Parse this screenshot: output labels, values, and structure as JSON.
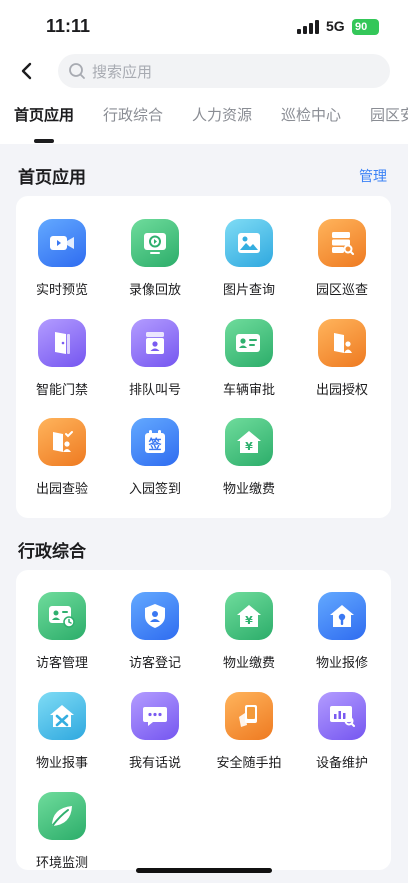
{
  "status_bar": {
    "time": "11:11",
    "network": "5G",
    "battery": "90"
  },
  "search": {
    "placeholder": "搜索应用"
  },
  "tabs": [
    {
      "label": "首页应用",
      "active": true
    },
    {
      "label": "行政综合"
    },
    {
      "label": "人力资源"
    },
    {
      "label": "巡检中心"
    },
    {
      "label": "园区安"
    }
  ],
  "section_home": {
    "title": "首页应用",
    "manage_label": "管理",
    "apps": [
      {
        "label": "实时预览",
        "icon": "video-camera-icon",
        "color": "blue"
      },
      {
        "label": "录像回放",
        "icon": "playback-icon",
        "color": "green"
      },
      {
        "label": "图片查询",
        "icon": "image-icon",
        "color": "cyan"
      },
      {
        "label": "园区巡查",
        "icon": "server-search-icon",
        "color": "orange"
      },
      {
        "label": "智能门禁",
        "icon": "door-icon",
        "color": "purple"
      },
      {
        "label": "排队叫号",
        "icon": "queue-ticket-icon",
        "color": "purple"
      },
      {
        "label": "车辆审批",
        "icon": "id-card-icon",
        "color": "green"
      },
      {
        "label": "出园授权",
        "icon": "exit-door-person-icon",
        "color": "orange"
      },
      {
        "label": "出园查验",
        "icon": "exit-check-icon",
        "color": "orange"
      },
      {
        "label": "入园签到",
        "icon": "sign-in-calendar-icon",
        "color": "blue",
        "glyph": "签"
      },
      {
        "label": "物业缴费",
        "icon": "house-yen-icon",
        "color": "green",
        "glyph": "¥"
      }
    ]
  },
  "section_admin": {
    "title": "行政综合",
    "apps": [
      {
        "label": "访客管理",
        "icon": "visitor-card-icon",
        "color": "green"
      },
      {
        "label": "访客登记",
        "icon": "shield-person-icon",
        "color": "blue"
      },
      {
        "label": "物业缴费",
        "icon": "house-yen-icon",
        "color": "green",
        "glyph": "¥"
      },
      {
        "label": "物业报修",
        "icon": "house-wrench-icon",
        "color": "blue"
      },
      {
        "label": "物业报事",
        "icon": "house-tools-icon",
        "color": "cyan"
      },
      {
        "label": "我有话说",
        "icon": "chat-bubble-icon",
        "color": "purple"
      },
      {
        "label": "安全随手拍",
        "icon": "hand-phone-icon",
        "color": "orange"
      },
      {
        "label": "设备维护",
        "icon": "monitor-chart-icon",
        "color": "purple"
      },
      {
        "label": "环境监测",
        "icon": "leaf-icon",
        "color": "green"
      }
    ]
  }
}
